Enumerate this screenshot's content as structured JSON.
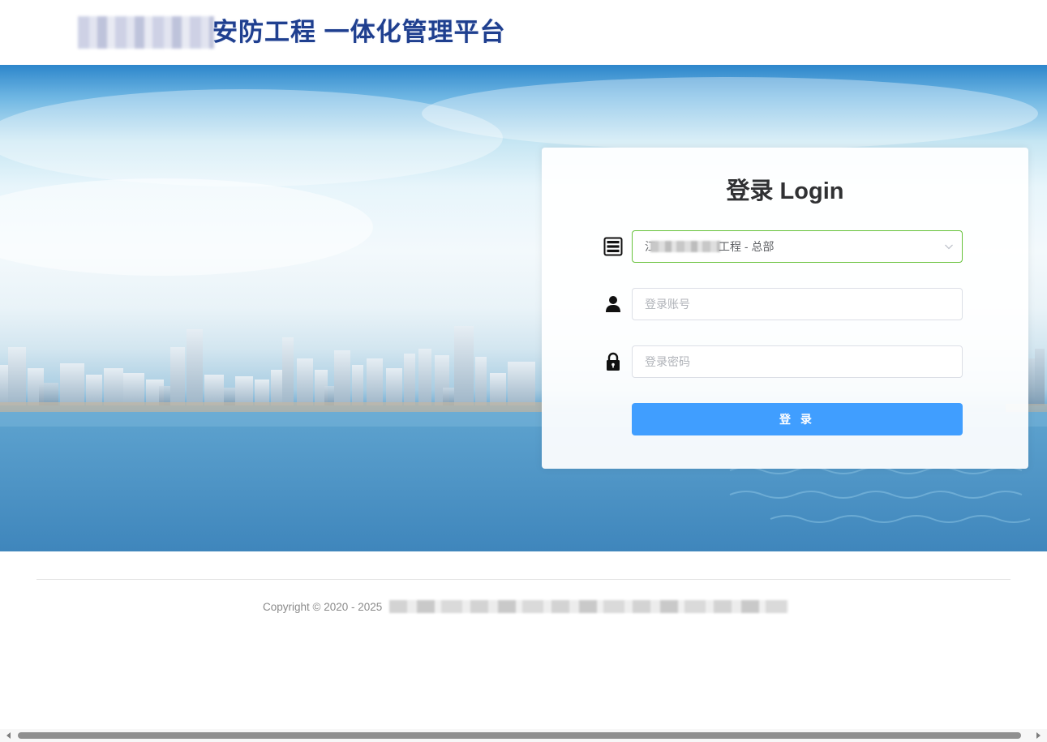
{
  "header": {
    "title": "安防工程 一体化管理平台"
  },
  "login": {
    "title": "登录 Login",
    "company_select": {
      "prefix": "江",
      "value_suffix": "工程 - 总部"
    },
    "username_placeholder": "登录账号",
    "password_placeholder": "登录密码",
    "submit_label": "登 录"
  },
  "footer": {
    "copyright": "Copyright © 2020 - 2025"
  },
  "colors": {
    "primary_button": "#409eff",
    "select_border_active": "#67c23a",
    "header_title": "#1f3f8f"
  },
  "icons": {
    "company": "server-stack-icon",
    "username": "user-icon",
    "password": "lock-icon",
    "select": "chevron-down-icon"
  }
}
